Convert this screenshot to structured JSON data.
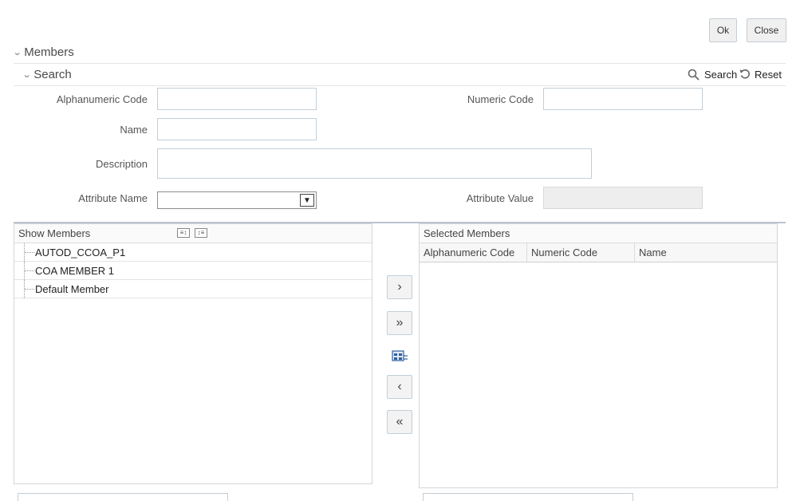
{
  "buttons": {
    "ok": "Ok",
    "close": "Close"
  },
  "sections": {
    "members": "Members",
    "search": "Search"
  },
  "search_actions": {
    "search": "Search",
    "reset": "Reset"
  },
  "form": {
    "alphanumeric_code_label": "Alphanumeric Code",
    "alphanumeric_code_value": "",
    "numeric_code_label": "Numeric Code",
    "numeric_code_value": "",
    "name_label": "Name",
    "name_value": "",
    "description_label": "Description",
    "description_value": "",
    "attribute_name_label": "Attribute Name",
    "attribute_name_selected": "",
    "attribute_value_label": "Attribute Value",
    "attribute_value_value": ""
  },
  "show_members": {
    "title": "Show Members",
    "items": [
      "AUTOD_CCOA_P1",
      "COA MEMBER 1",
      "Default Member"
    ]
  },
  "selected_members": {
    "title": "Selected Members",
    "columns": [
      "Alphanumeric Code",
      "Numeric Code",
      "Name"
    ]
  },
  "icons": {
    "move_right": "chevron-right-icon",
    "move_all_right": "double-chevron-right-icon",
    "hierarchy": "hierarchy-icon",
    "move_left": "chevron-left-icon",
    "move_all_left": "double-chevron-left-icon"
  }
}
